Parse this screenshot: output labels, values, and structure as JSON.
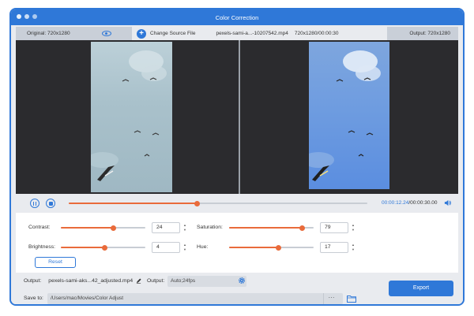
{
  "window": {
    "title": "Color Correction"
  },
  "infobar": {
    "original_label": "Original: 720x1280",
    "change_source_label": "Change Source File",
    "filename": "pexels-sami-a...-10207542.mp4",
    "file_info": "720x1280/00:00:30",
    "output_label": "Output: 720x1280"
  },
  "playback": {
    "current_time": "00:00:12.24",
    "total_time": "/00:00:30.00",
    "progress": 0.43
  },
  "adjustments": {
    "contrast": {
      "label": "Contrast:",
      "value": "24",
      "level": 0.62
    },
    "brightness": {
      "label": "Brightness:",
      "value": "4",
      "level": 0.52
    },
    "saturation": {
      "label": "Saturation:",
      "value": "79",
      "level": 0.86
    },
    "hue": {
      "label": "Hue:",
      "value": "17",
      "level": 0.58
    }
  },
  "reset_label": "Reset",
  "output": {
    "label": "Output:",
    "filename": "pexels-sami-aks...42_adjusted.mp4",
    "format_label": "Output:",
    "format_value": "Auto;24fps"
  },
  "save": {
    "label": "Save to:",
    "path": "/Users/mac/Movies/Color Adjust",
    "browse_label": "···"
  },
  "export_label": "Export",
  "colors": {
    "accent": "#2f78d8",
    "slider": "#e96b3b",
    "preview_bg": "#2b2b2e"
  }
}
